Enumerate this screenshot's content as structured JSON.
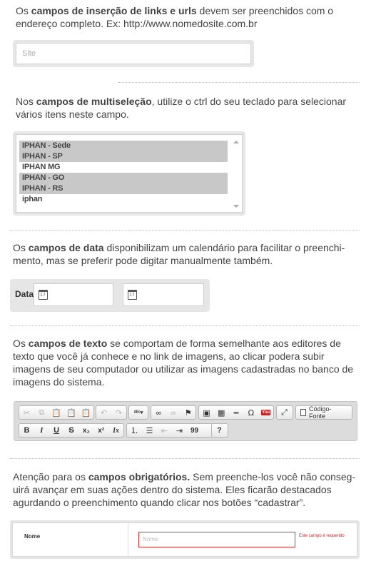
{
  "sections": {
    "links": {
      "pre": "Os ",
      "bold": "campos de inserção de links e urls",
      "post": " devem ser preenchidos com o",
      "line2": "endereço completo. Ex: http://www.nomedosite.com.br",
      "input_placeholder": "Site"
    },
    "multiselect": {
      "pre": "Nos ",
      "bold": "campos de multiseleção",
      "post": ", utilize o ctrl do seu teclado para selecionar",
      "line2": "vários itens neste campo.",
      "options": [
        {
          "label": "IPHAN - Sede",
          "selected": true
        },
        {
          "label": "IPHAN - SP",
          "selected": true
        },
        {
          "label": "IPHAN MG",
          "selected": false
        },
        {
          "label": "IPHAN - GO",
          "selected": true
        },
        {
          "label": "IPHAN - RS",
          "selected": true
        },
        {
          "label": "iphan",
          "selected": false
        }
      ]
    },
    "date": {
      "pre": "Os ",
      "bold": "campos de data",
      "post": " disponibilizam um calendário para facilitar o preenchi-",
      "line2": "mento, mas se preferir pode digitar manualmente também.",
      "label": "Data",
      "calendar_icon_text": "17"
    },
    "text": {
      "pre": "Os ",
      "bold": "campos de texto",
      "post": " se comportam de forma semelhante aos editores de",
      "line2": "texto que você já conhece e no link de imagens, ao clicar podera subir",
      "line3": "imagens de seu computador ou utilizar as imagens cadastradas no banco de",
      "line4": "imagens do sistema.",
      "toolbar": {
        "source_label": "Código-Fonte",
        "youtube_label": "You",
        "bold": "B",
        "italic": "I",
        "underline": "U",
        "strike": "S",
        "subscript": "x₂",
        "superscript": "x²",
        "remove_format": "Ix",
        "blockquote": "99",
        "help": "?"
      }
    },
    "required": {
      "pre": "Atenção para os ",
      "bold": "campos obrigatórios.",
      "post": " Sem preenche-los você não conseg-",
      "line2": "uirá avançar em suas ações dentro do sistema. Eles ficarão destacados",
      "line3": "agurdando o preenchimento quando clicar nos botões “cadastrar”.",
      "field_label": "Nome",
      "field_placeholder": "Nome",
      "error_message": "Este campo é requerido"
    }
  },
  "colors": {
    "text": "#444444",
    "panel": "#e6e6e6",
    "selected": "#c8c8c8",
    "error": "#e02020"
  }
}
